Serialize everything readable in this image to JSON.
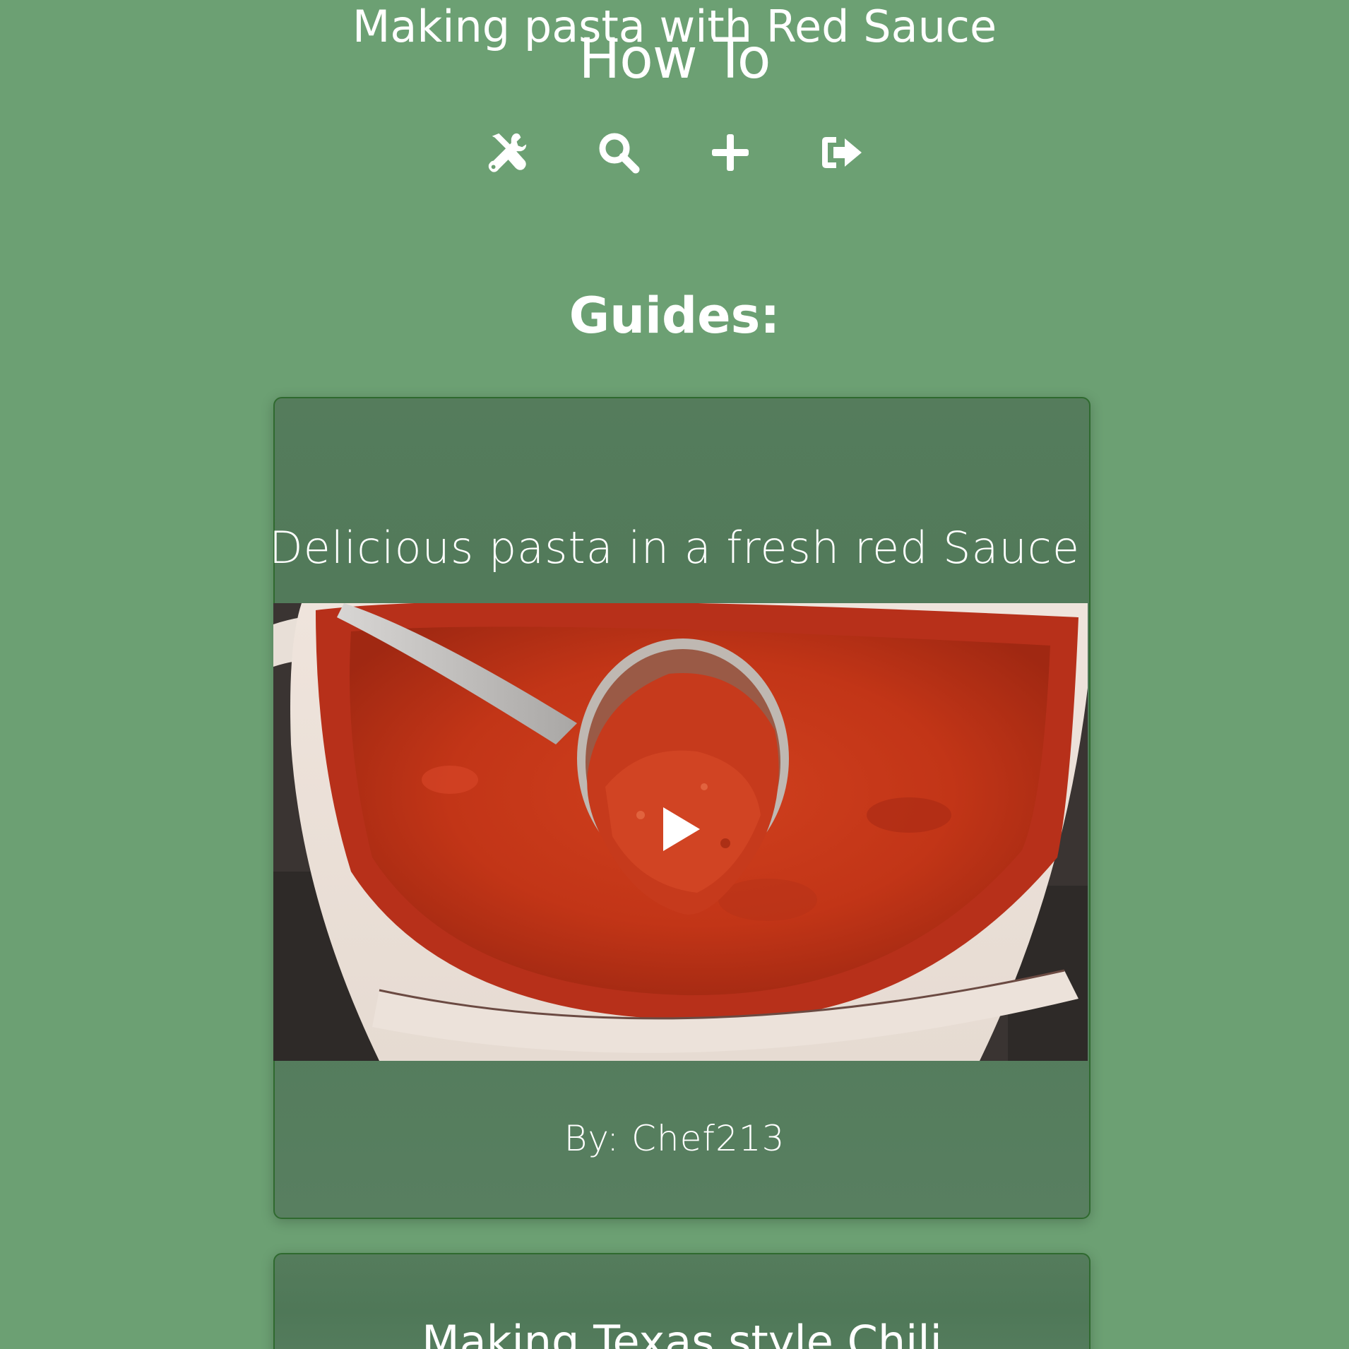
{
  "app": {
    "title": "How To"
  },
  "nav": {
    "items": [
      {
        "icon": "tools-icon"
      },
      {
        "icon": "search-icon"
      },
      {
        "icon": "plus-icon"
      },
      {
        "icon": "logout-icon"
      }
    ]
  },
  "main": {
    "heading": "Guides:"
  },
  "guides": [
    {
      "title": "Making pasta with Red Sauce",
      "description": "Delicious pasta in a fresh red Sauce",
      "media_icon": "play-icon",
      "author": "By: Chef213"
    },
    {
      "title": "Making Texas style Chili"
    }
  ],
  "colors": {
    "page_background": "#6ca073",
    "card_background": "#557c5c",
    "card_border": "#2f6a2f",
    "text": "#ffffff"
  }
}
